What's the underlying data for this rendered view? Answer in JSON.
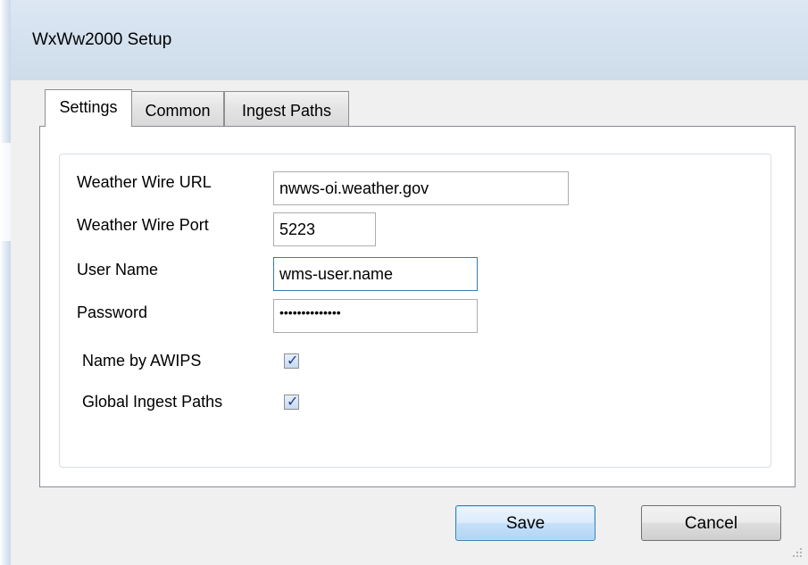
{
  "window": {
    "title": "WxWw2000 Setup"
  },
  "tabs": [
    {
      "label": "Settings",
      "active": true
    },
    {
      "label": "Common",
      "active": false
    },
    {
      "label": "Ingest Paths",
      "active": false
    }
  ],
  "form": {
    "url_label": "Weather Wire URL",
    "url_value": "nwws-oi.weather.gov",
    "port_label": "Weather Wire Port",
    "port_value": "5223",
    "user_label": "User Name",
    "user_value": "wms-user.name",
    "password_label": "Password",
    "password_value": "••••••••••••••",
    "awips_label": "Name by AWIPS",
    "awips_checked": true,
    "global_label": "Global Ingest Paths",
    "global_checked": true
  },
  "buttons": {
    "save": "Save",
    "cancel": "Cancel"
  },
  "colors": {
    "title_bar": "#d3e0ee",
    "client_bg": "#f0f0f0",
    "default_button_border": "#3c7fb1"
  },
  "icons": {
    "checkmark": "check-icon",
    "resize": "resize-grip-icon"
  }
}
